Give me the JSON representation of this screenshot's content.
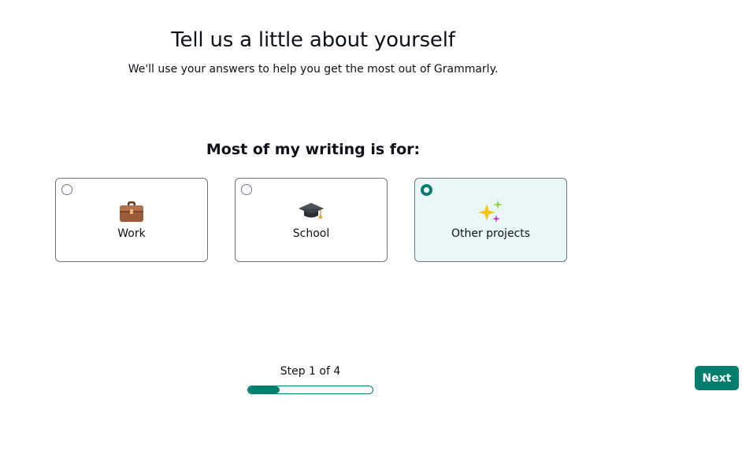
{
  "header": {
    "title": "Tell us a little about yourself",
    "subtitle": "We'll use your answers to help you get the most out of Grammarly."
  },
  "question": {
    "label": "Most of my writing is for:",
    "options": [
      {
        "label": "Work",
        "icon": "briefcase-icon",
        "selected": false
      },
      {
        "label": "School",
        "icon": "graduation-cap-icon",
        "selected": false
      },
      {
        "label": "Other projects",
        "icon": "sparkles-icon",
        "selected": true
      }
    ]
  },
  "progress": {
    "label": "Step 1 of 4",
    "current_step": 1,
    "total_steps": 4,
    "fill_fraction": 0.25
  },
  "actions": {
    "next_label": "Next"
  },
  "colors": {
    "accent": "#027e6f",
    "selected_bg": "#e9f8f6",
    "border": "#6d758d",
    "text": "#0e101a"
  }
}
